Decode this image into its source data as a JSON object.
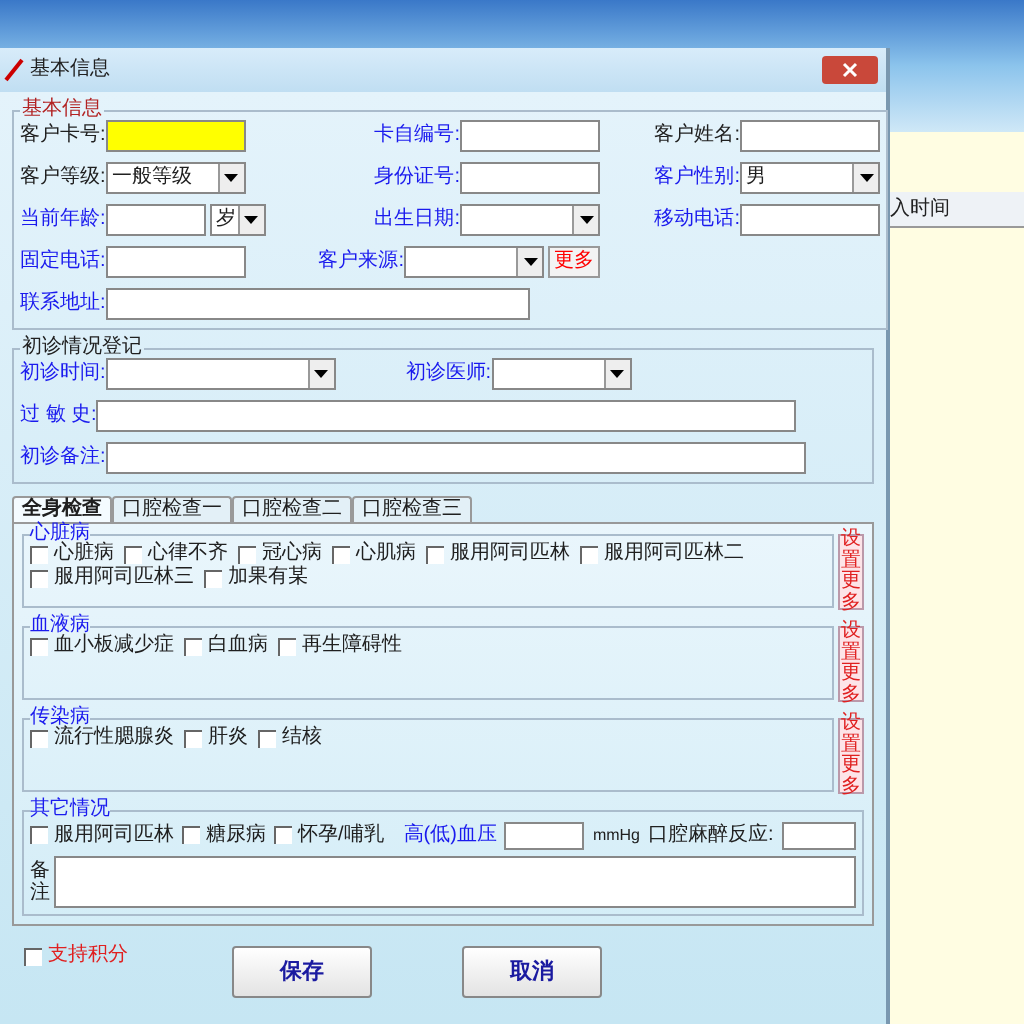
{
  "background_table": {
    "columns": [
      "入时间"
    ]
  },
  "dialog": {
    "title": "基本信息"
  },
  "basic_info": {
    "title": "基本信息",
    "rows": [
      [
        {
          "label": "客户卡号:",
          "color": "#202020",
          "controls": [
            {
              "kind": "text",
              "focused": true
            }
          ]
        },
        {
          "label": "卡自编号:",
          "color": "#1a1aee",
          "controls": [
            {
              "kind": "text",
              "focused": false
            }
          ]
        },
        {
          "label": "客户姓名:",
          "color": "#202020",
          "controls": [
            {
              "kind": "text",
              "focused": false
            }
          ]
        }
      ],
      [
        {
          "label": "客户等级:",
          "color": "#202020",
          "controls": [
            {
              "kind": "select",
              "value": "一般等级"
            }
          ]
        },
        {
          "label": "身份证号:",
          "color": "#1a1aee",
          "controls": [
            {
              "kind": "text",
              "focused": false
            }
          ]
        },
        {
          "label": "客户性别:",
          "color": "#1a1aee",
          "controls": [
            {
              "kind": "select",
              "value": "男"
            }
          ]
        }
      ],
      [
        {
          "label": "当前年龄:",
          "color": "#1a1aee",
          "controls": [
            {
              "kind": "short",
              "focused": false
            },
            {
              "kind": "mini_select",
              "value": "岁"
            }
          ]
        },
        {
          "label": "出生日期:",
          "color": "#1a1aee",
          "controls": [
            {
              "kind": "select"
            }
          ]
        },
        {
          "label": "移动电话:",
          "color": "#1a1aee",
          "controls": [
            {
              "kind": "text",
              "focused": false
            }
          ]
        }
      ],
      [
        {
          "label": "固定电话:",
          "color": "#1a1aee",
          "controls": [
            {
              "kind": "text",
              "focused": false
            }
          ]
        },
        {
          "label": "客户来源:",
          "color": "#1a1aee",
          "controls": [
            {
              "kind": "select"
            },
            {
              "kind": "button",
              "value": "更多"
            }
          ]
        }
      ],
      [
        {
          "label": "联系地址:",
          "color": "#1a1aee",
          "controls": [
            {
              "kind": "wide",
              "focused": false
            }
          ]
        }
      ]
    ]
  },
  "first_visit": {
    "title": "初诊情况登记",
    "time_label": "初诊时间:",
    "doctor_label": "初诊医师:",
    "allergy_label": "过 敏 史:",
    "note_label": "初诊备注:"
  },
  "tabs": [
    {
      "label": "全身检查",
      "selected": true
    },
    {
      "label": "口腔检查一",
      "selected": false
    },
    {
      "label": "口腔检查二",
      "selected": false
    },
    {
      "label": "口腔检查三",
      "selected": false
    }
  ],
  "groups": [
    {
      "title": "心脏病",
      "side_button": "设置更多",
      "items": [
        {
          "label": "心脏病",
          "checked": false
        },
        {
          "label": "心律不齐",
          "checked": false
        },
        {
          "label": "冠心病",
          "checked": false
        },
        {
          "label": "心肌病",
          "checked": false
        },
        {
          "label": "服用阿司匹林",
          "checked": false
        },
        {
          "label": "服用阿司匹林二",
          "checked": false
        },
        {
          "label": "服用阿司匹林三",
          "checked": false
        },
        {
          "label": "加果有某",
          "checked": false
        }
      ]
    },
    {
      "title": "血液病",
      "side_button": "设置更多",
      "items": [
        {
          "label": "血小板减少症",
          "checked": false
        },
        {
          "label": "白血病",
          "checked": false
        },
        {
          "label": "再生障碍性",
          "checked": false
        }
      ]
    },
    {
      "title": "传染病",
      "side_button": "设置更多",
      "items": [
        {
          "label": "流行性腮腺炎",
          "checked": false
        },
        {
          "label": "肝炎",
          "checked": false
        },
        {
          "label": "结核",
          "checked": false
        }
      ]
    }
  ],
  "other": {
    "title": "其它情况",
    "items": [
      {
        "label": "服用阿司匹林",
        "checked": false
      },
      {
        "label": "糖尿病",
        "checked": false
      },
      {
        "label": "怀孕/哺乳",
        "checked": false
      }
    ],
    "bp_label": "高(低)血压",
    "bp_unit": "mmHg",
    "anesthesia_label": "口腔麻醉反应:",
    "note_label": "备注"
  },
  "support_points": {
    "label": "支持积分",
    "checked": false
  },
  "buttons": [
    "保存",
    "取消"
  ]
}
